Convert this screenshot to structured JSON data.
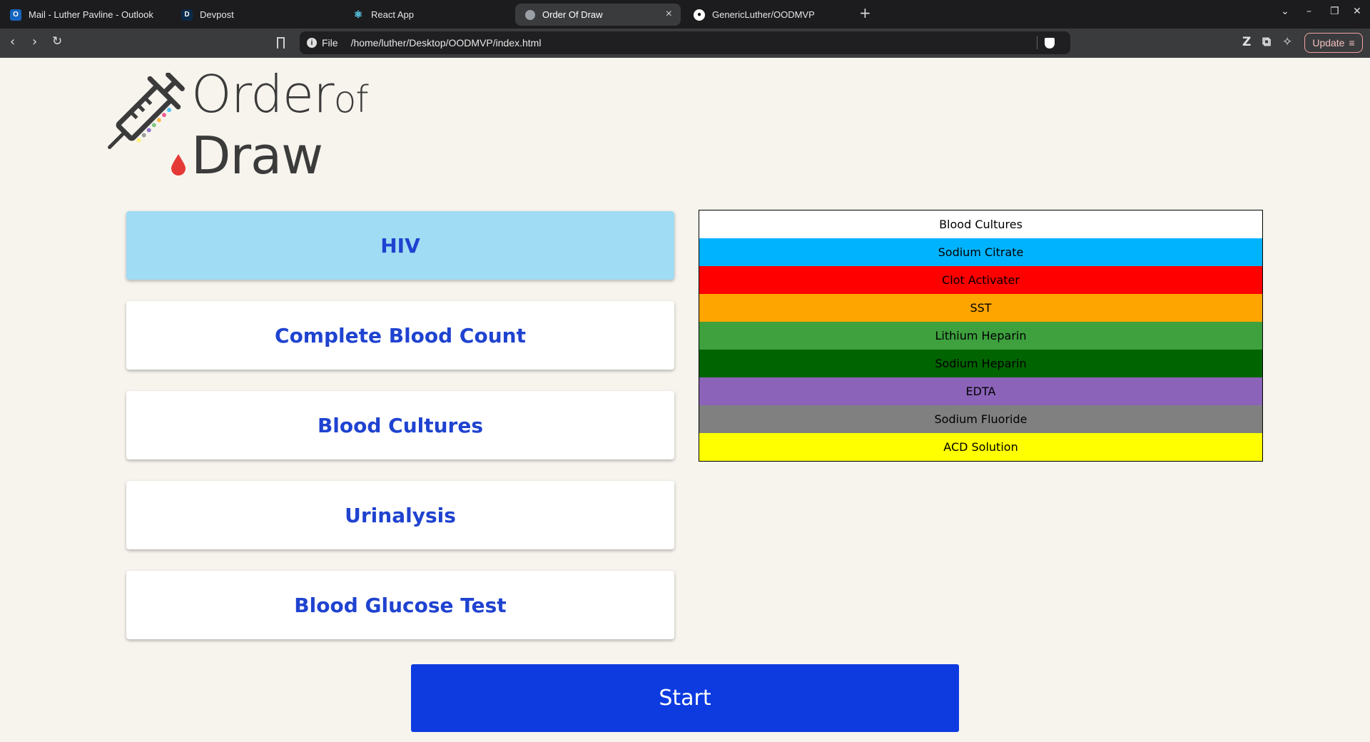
{
  "browser": {
    "tabs": [
      {
        "title": "Mail - Luther Pavline - Outlook",
        "icon": "outlook-icon",
        "color": "#1565c0"
      },
      {
        "title": "Devpost",
        "icon": "devpost-icon",
        "color": "#0b2a4a"
      },
      {
        "title": "React App",
        "icon": "react-icon",
        "color": "#61dafb"
      },
      {
        "title": "Order Of Draw",
        "icon": "globe-icon",
        "color": "#9aa0a6",
        "active": true
      },
      {
        "title": "GenericLuther/OODMVP",
        "icon": "github-icon",
        "color": "#ffffff"
      }
    ],
    "url_scheme": "File",
    "url_path": "/home/luther/Desktop/OODMVP/index.html",
    "update_label": "Update"
  },
  "logo": {
    "word1": "Order",
    "word2": "of",
    "word3": "Draw"
  },
  "tests": [
    {
      "label": "HIV",
      "selected": true
    },
    {
      "label": "Complete Blood Count",
      "selected": false
    },
    {
      "label": "Blood Cultures",
      "selected": false
    },
    {
      "label": "Urinalysis",
      "selected": false
    },
    {
      "label": "Blood Glucose Test",
      "selected": false
    }
  ],
  "tubes": [
    {
      "label": "Blood Cultures",
      "color": "#ffffff"
    },
    {
      "label": "Sodium Citrate",
      "color": "#00b3ff"
    },
    {
      "label": "Clot Activater",
      "color": "#ff0000"
    },
    {
      "label": "SST",
      "color": "#ffa500"
    },
    {
      "label": "Lithium Heparin",
      "color": "#3ea13e"
    },
    {
      "label": "Sodium Heparin",
      "color": "#006400"
    },
    {
      "label": "EDTA",
      "color": "#8b63b8"
    },
    {
      "label": "Sodium Fluoride",
      "color": "#808080"
    },
    {
      "label": "ACD Solution",
      "color": "#ffff00"
    }
  ],
  "start_label": "Start"
}
